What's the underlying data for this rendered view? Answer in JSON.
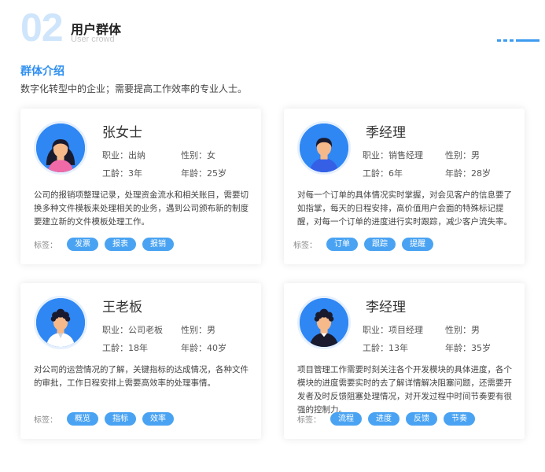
{
  "section": {
    "number": "02",
    "title": "用户群体",
    "subtitle": "User crowd"
  },
  "intro": {
    "title": "群体介绍",
    "text": "数字化转型中的企业；需要提高工作效率的专业人士。"
  },
  "colors": {
    "accent": "#2f8ff0",
    "tag": "#4aa3f2",
    "number": "#cfe5fb"
  },
  "cards": [
    {
      "name": "张女士",
      "job": "职业：出纳",
      "gender": "性别：女",
      "tenure": "工龄：3年",
      "age": "年龄：25岁",
      "desc": "公司的报销项整理记录，处理资金流水和相关账目，需要切换多种文件模板来处理相关的业务，遇到公司颁布新的制度要建立新的文件模板处理工作。",
      "tags_label": "标签：",
      "tags": [
        "发票",
        "报表",
        "报销"
      ],
      "avatar": "female-avatar-icon"
    },
    {
      "name": "季经理",
      "job": "职业：销售经理",
      "gender": "性别：男",
      "tenure": "工龄：6年",
      "age": "年龄：28岁",
      "desc": "对每一个订单的具体情况实时掌握，对会见客户的信息要了如指掌，每天的日程安排，高价值用户会面的特殊标记提醒，对每一个订单的进度进行实时跟踪，减少客户流失率。",
      "tags_label": "标签：",
      "tags": [
        "订单",
        "跟踪",
        "提醒"
      ],
      "avatar": "male-avatar-icon"
    },
    {
      "name": "王老板",
      "job": "职业：公司老板",
      "gender": "性别：男",
      "tenure": "工龄：18年",
      "age": "年龄：40岁",
      "desc": "对公司的运营情况的了解，关键指标的达成情况，各种文件的审批，工作日程安排上需要高效率的处理事情。",
      "tags_label": "标签：",
      "tags": [
        "概览",
        "指标",
        "效率"
      ],
      "avatar": "male-curly-avatar-icon"
    },
    {
      "name": "李经理",
      "job": "职业：项目经理",
      "gender": "性别：男",
      "tenure": "工龄：13年",
      "age": "年龄：35岁",
      "desc": "项目管理工作需要时刻关注各个开发模块的具体进度，各个模块的进度需要实时的去了解详情解决阻塞问题，还需要开发者及时反馈阻塞处理情况，对开发过程中时间节奏要有很强的控制力。",
      "tags_label": "标签：",
      "tags": [
        "流程",
        "进度",
        "反馈",
        "节奏"
      ],
      "avatar": "male-dark-avatar-icon"
    }
  ]
}
